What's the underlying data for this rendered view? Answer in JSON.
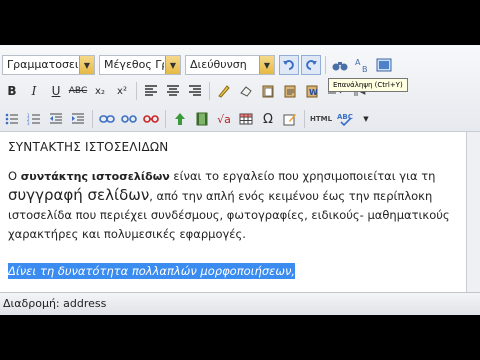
{
  "toolbar": {
    "font_select": "Γραμματοσειρά",
    "size_select": "Μέγεθος Γραμ",
    "address_select": "Διεύθυνση",
    "tooltip": "Επανάληψη (Ctrl+Y)",
    "icons": [
      "undo-icon",
      "redo-icon",
      "find-icon",
      "replace-icon",
      "fullscreen-icon",
      "bold-icon",
      "italic-icon",
      "underline-icon",
      "strikethrough-icon",
      "subscript-icon",
      "superscript-icon",
      "align-left-icon",
      "align-center-icon",
      "align-right-icon",
      "clean-icon",
      "eraser-icon",
      "paste-icon",
      "paste-text-icon",
      "paste-word-icon",
      "ltr-icon",
      "rtl-icon",
      "bullet-list-icon",
      "number-list-icon",
      "outdent-icon",
      "indent-icon",
      "link-icon",
      "unlink-icon",
      "anchor-icon",
      "image-icon",
      "media-icon",
      "formula-icon",
      "table-icon",
      "special-char-icon",
      "edit-icon",
      "html-icon",
      "spellcheck-icon"
    ]
  },
  "content": {
    "heading": "ΣΥΝΤΑΚΤΗΣ ΙΣΤΟΣΕΛΙΔΩΝ",
    "para_start": "Ο ",
    "para_bold": "συντάκτης ιστοσελίδων",
    "para_mid": " είναι το εργαλείο που χρησιμοποιείται για τη ",
    "para_large": "συγγραφή σελίδων",
    "para_end": ", από την απλή ενός κειμένου έως την περίπλοκη ιστοσελίδα που περιέχει συνδέσμους, φωτογραφίες, ειδικούς- μαθηματικούς χαρακτήρες και πολυμεσικές εφαρμογές.",
    "selected": "Δίνει τη δυνατότητα πολλαπλών μορφοποιήσεων,"
  },
  "status": {
    "label": "Διαδρομή:",
    "path": "address"
  }
}
